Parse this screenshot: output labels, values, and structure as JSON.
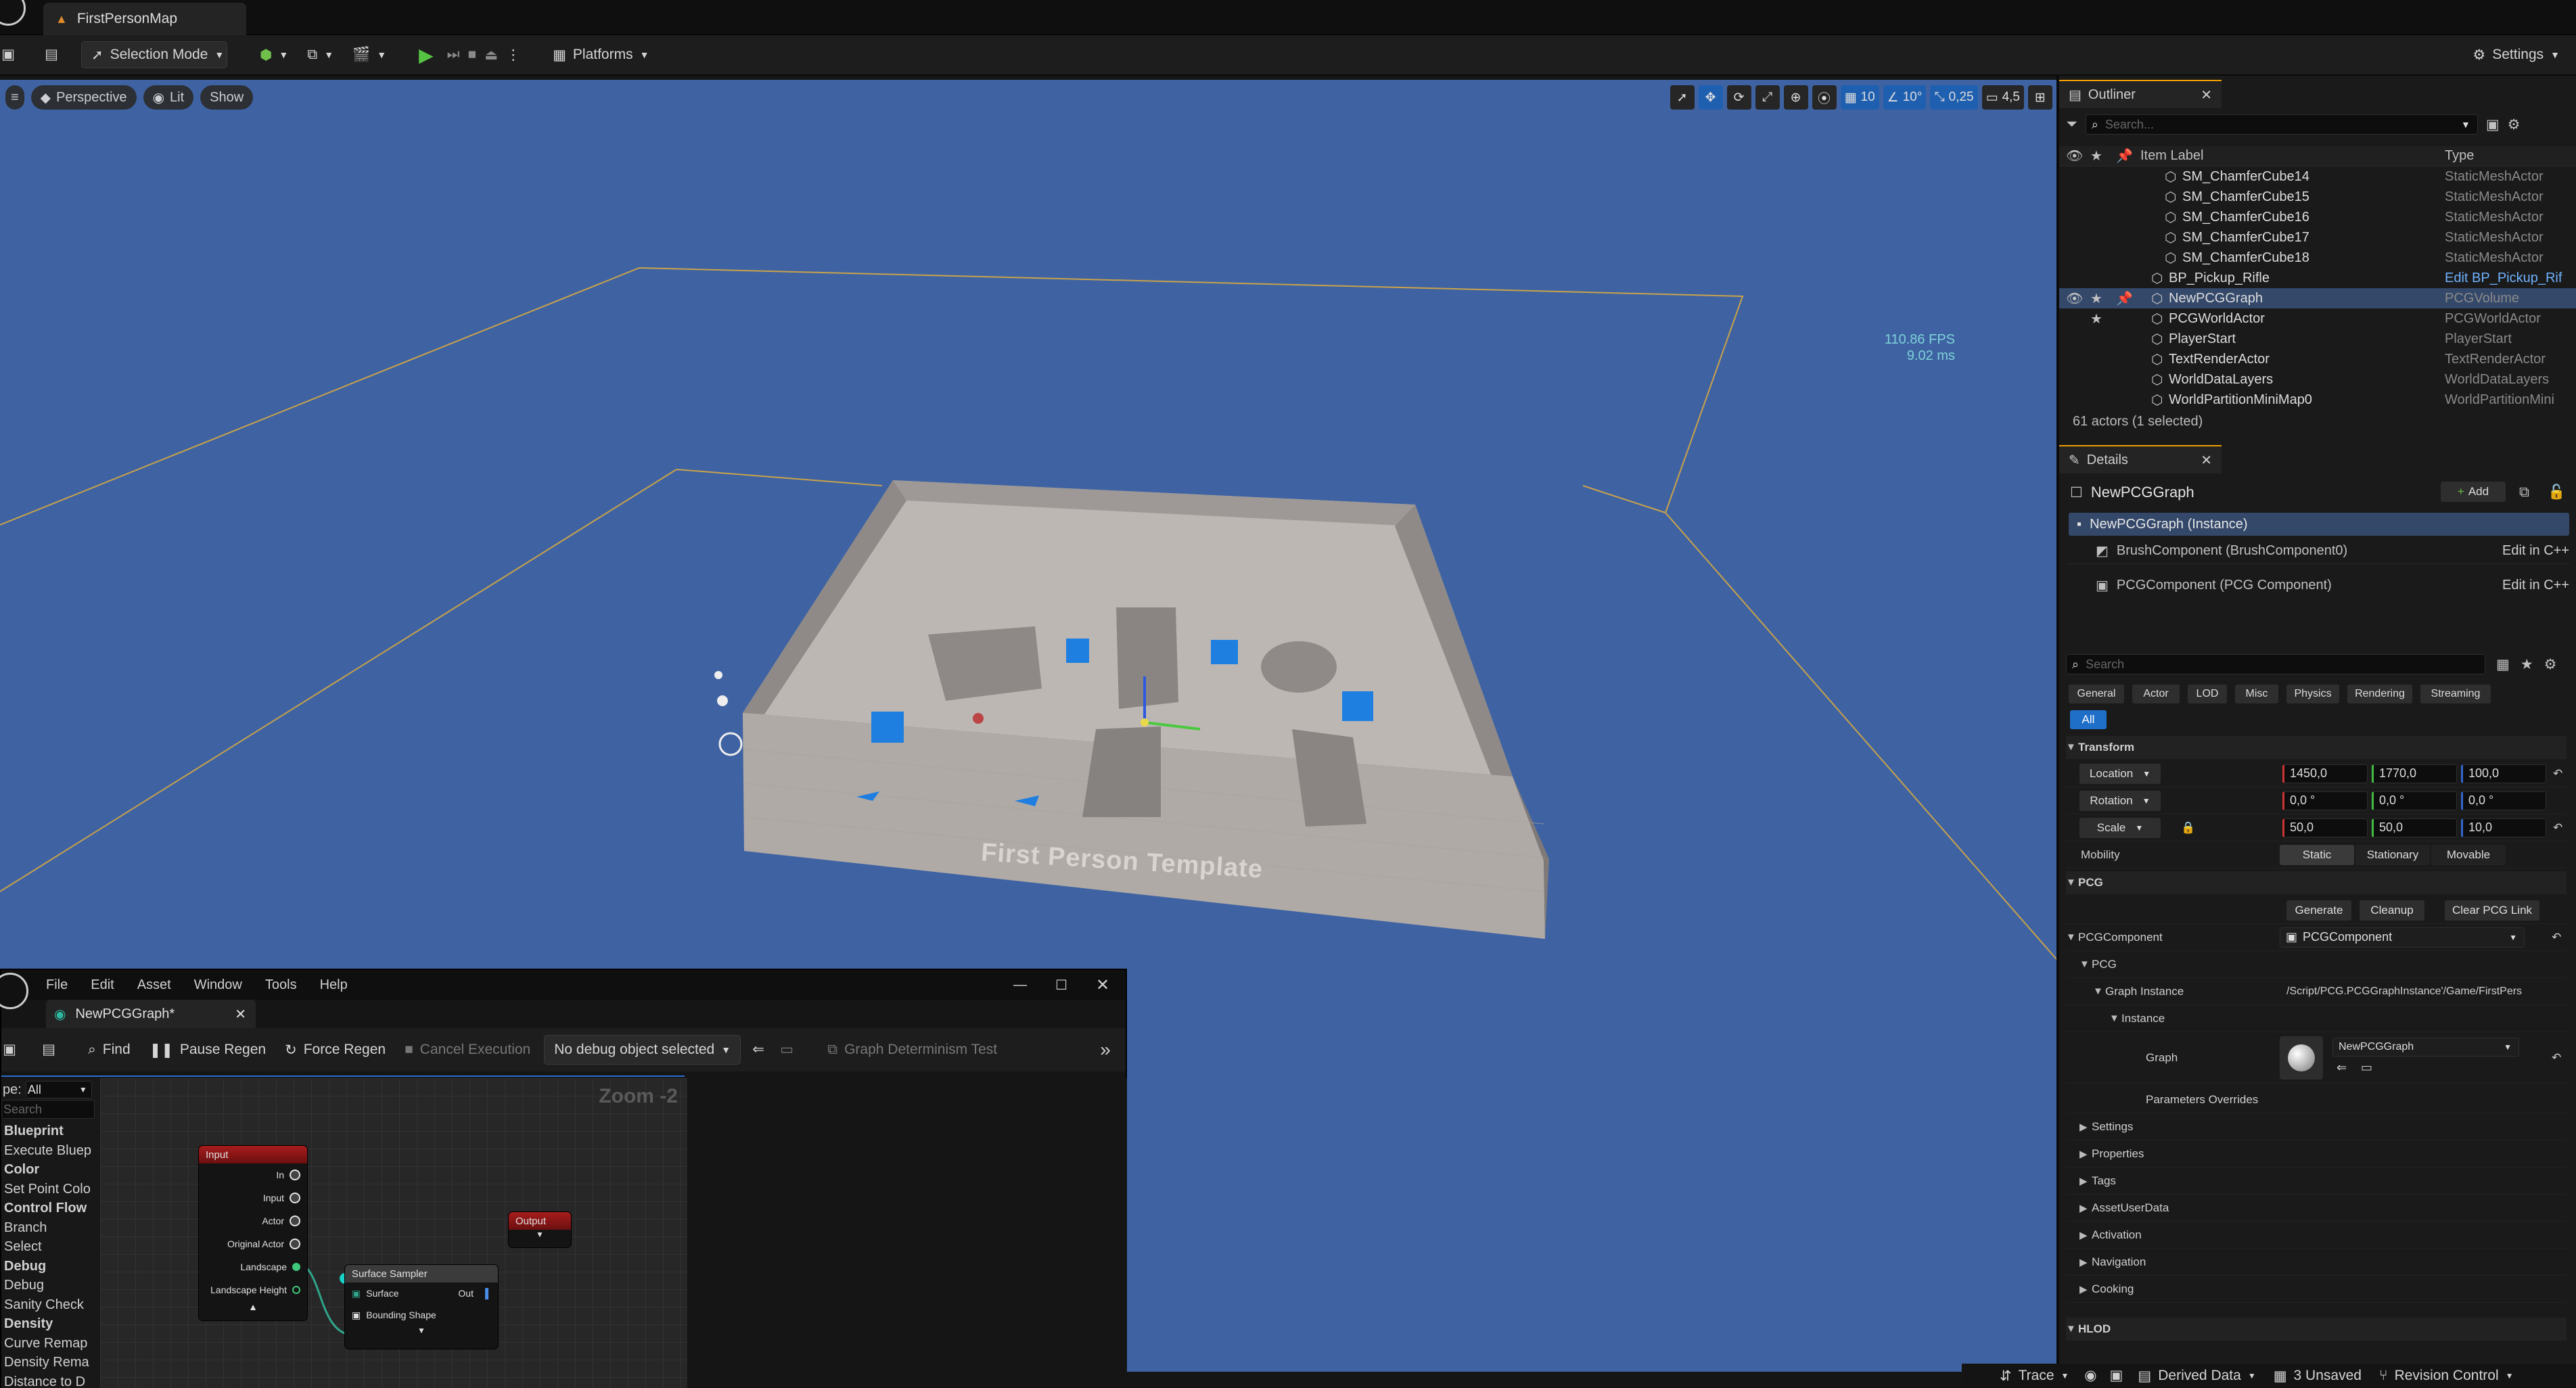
{
  "titlebar": {
    "map_tab": "FirstPersonMap"
  },
  "toolbar": {
    "selection_mode": "Selection Mode",
    "platforms": "Platforms",
    "settings": "Settings"
  },
  "viewport": {
    "perspective": "Perspective",
    "lit": "Lit",
    "show": "Show",
    "grid_snap": "10",
    "rot_snap": "10°",
    "scale_snap": "0,25",
    "cam_speed": "4,5",
    "fps": "110.86 FPS",
    "ms": "9.02 ms",
    "level_label": "First Person Template"
  },
  "outliner": {
    "title": "Outliner",
    "search_placeholder": "Search...",
    "col_label": "Item Label",
    "col_type": "Type",
    "rows": [
      {
        "label": "SM_ChamferCube14",
        "type": "StaticMeshActor",
        "indent": 2
      },
      {
        "label": "SM_ChamferCube15",
        "type": "StaticMeshActor",
        "indent": 2
      },
      {
        "label": "SM_ChamferCube16",
        "type": "StaticMeshActor",
        "indent": 2
      },
      {
        "label": "SM_ChamferCube17",
        "type": "StaticMeshActor",
        "indent": 2
      },
      {
        "label": "SM_ChamferCube18",
        "type": "StaticMeshActor",
        "indent": 2
      },
      {
        "label": "BP_Pickup_Rifle",
        "type": "Edit BP_Pickup_Rif",
        "indent": 1,
        "link": true
      },
      {
        "label": "NewPCGGraph",
        "type": "PCGVolume",
        "indent": 1,
        "selected": true
      },
      {
        "label": "PCGWorldActor",
        "type": "PCGWorldActor",
        "indent": 1
      },
      {
        "label": "PlayerStart",
        "type": "PlayerStart",
        "indent": 1
      },
      {
        "label": "TextRenderActor",
        "type": "TextRenderActor",
        "indent": 1
      },
      {
        "label": "WorldDataLayers",
        "type": "WorldDataLayers",
        "indent": 1
      },
      {
        "label": "WorldPartitionMiniMap0",
        "type": "WorldPartitionMini",
        "indent": 1
      }
    ],
    "footer": "61 actors (1 selected)"
  },
  "details": {
    "title": "Details",
    "actor": "NewPCGGraph",
    "add": "Add",
    "instance": "NewPCGGraph (Instance)",
    "brush": "BrushComponent (BrushComponent0)",
    "pcgcomp": "PCGComponent (PCG Component)",
    "edit_cpp": "Edit in C++",
    "search_placeholder": "Search",
    "filters": [
      "General",
      "Actor",
      "LOD",
      "Misc",
      "Physics",
      "Rendering",
      "Streaming"
    ],
    "filter_all": "All",
    "transform": "Transform",
    "location": "Location",
    "loc": [
      "1450,0",
      "1770,0",
      "100,0"
    ],
    "rotation": "Rotation",
    "rot": [
      "0,0 °",
      "0,0 °",
      "0,0 °"
    ],
    "scale": "Scale",
    "scl": [
      "50,0",
      "50,0",
      "10,0"
    ],
    "mobility": "Mobility",
    "mob": [
      "Static",
      "Stationary",
      "Movable"
    ],
    "pcg": "PCG",
    "generate": "Generate",
    "cleanup": "Cleanup",
    "clear_link": "Clear PCG Link",
    "pcg_component": "PCGComponent",
    "pcg_component_val": "PCGComponent",
    "pcg_sub": "PCG",
    "graph_instance": "Graph Instance",
    "graph_instance_val": "/Script/PCG.PCGGraphInstance'/Game/FirstPers",
    "instance_lbl": "Instance",
    "graph": "Graph",
    "graph_val": "NewPCGGraph",
    "params": "Parameters Overrides",
    "sections": [
      "Settings",
      "Properties",
      "Tags",
      "AssetUserData",
      "Activation",
      "Navigation",
      "Cooking"
    ],
    "hlod": "HLOD"
  },
  "pcg_editor": {
    "menu": [
      "File",
      "Edit",
      "Asset",
      "Window",
      "Tools",
      "Help"
    ],
    "tab": "NewPCGGraph*",
    "find": "Find",
    "pause": "Pause Regen",
    "force": "Force Regen",
    "cancel": "Cancel Execution",
    "debug": "No debug object selected",
    "determinism": "Graph Determinism Test",
    "type_lbl": "pe:",
    "type_val": "All",
    "search_placeholder": "Search",
    "palette": [
      {
        "t": "Blueprint",
        "h": true
      },
      {
        "t": "Execute Bluep"
      },
      {
        "t": "Color",
        "h": true
      },
      {
        "t": "Set Point Colo"
      },
      {
        "t": "Control Flow",
        "h": true
      },
      {
        "t": "Branch"
      },
      {
        "t": "Select"
      },
      {
        "t": "Debug",
        "h": true
      },
      {
        "t": "Debug"
      },
      {
        "t": "Sanity Check"
      },
      {
        "t": "Density",
        "h": true
      },
      {
        "t": "Curve Remap"
      },
      {
        "t": "Density Rema"
      },
      {
        "t": "Distance to D"
      }
    ],
    "zoom": "Zoom -2",
    "input_node": "Input",
    "input_pins": [
      "In",
      "Input",
      "Actor",
      "Original Actor",
      "Landscape",
      "Landscape Height"
    ],
    "output_node": "Output",
    "sampler_node": "Surface Sampler",
    "sampler_in": "Surface",
    "sampler_out": "Out",
    "sampler_bound": "Bounding Shape"
  },
  "statusbar": {
    "trace": "Trace",
    "derived": "Derived Data",
    "unsaved": "3 Unsaved",
    "revision": "Revision Control"
  }
}
